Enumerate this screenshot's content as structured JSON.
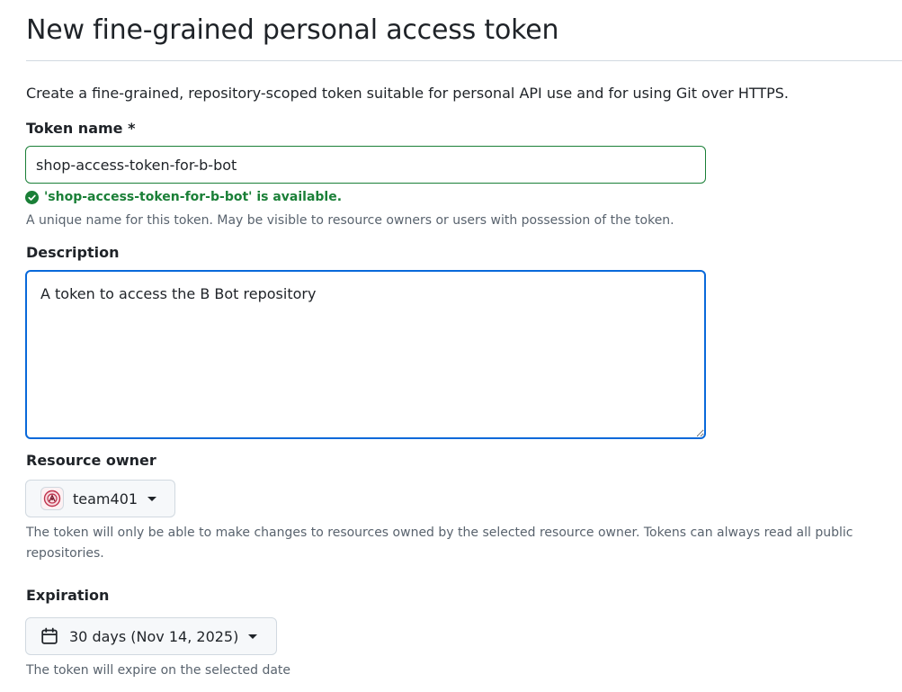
{
  "page": {
    "title": "New fine-grained personal access token",
    "intro": "Create a fine-grained, repository-scoped token suitable for personal API use and for using Git over HTTPS."
  },
  "token_name": {
    "label": "Token name *",
    "value": "shop-access-token-for-b-bot",
    "validation": "'shop-access-token-for-b-bot' is available.",
    "help": "A unique name for this token. May be visible to resource owners or users with possession of the token."
  },
  "description": {
    "label": "Description",
    "value": "A token to access the B Bot repository"
  },
  "resource_owner": {
    "label": "Resource owner",
    "selected": "team401",
    "help": "The token will only be able to make changes to resources owned by the selected resource owner. Tokens can always read all public repositories."
  },
  "expiration": {
    "label": "Expiration",
    "selected": "30 days (Nov 14, 2025)",
    "help": "The token will expire on the selected date"
  },
  "icons": {
    "validation": "check-circle-fill-icon",
    "owner_avatar": "team-avatar",
    "dropdown": "triangle-down-icon",
    "calendar": "calendar-icon"
  },
  "colors": {
    "success": "#1a7f37",
    "focus": "#0969da",
    "muted_text": "#59636e",
    "button_bg": "#f6f8fa"
  }
}
